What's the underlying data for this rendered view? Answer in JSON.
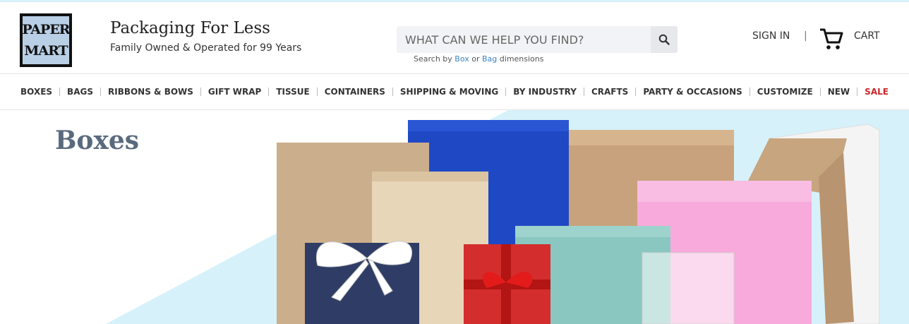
{
  "brand": {
    "logo_line1": "PAPER",
    "logo_line2": "MART",
    "title": "Packaging For Less",
    "subtitle": "Family Owned & Operated for 99 Years"
  },
  "search": {
    "placeholder": "WHAT CAN WE HELP YOU FIND?",
    "hint_prefix": "Search by",
    "hint_link1": "Box",
    "hint_middle": "or",
    "hint_link2": "Bag",
    "hint_suffix": "dimensions",
    "icon": "search-icon"
  },
  "account": {
    "sign_in": "SIGN IN",
    "separator": "|",
    "cart_label": "CART",
    "cart_icon": "cart-icon"
  },
  "nav": {
    "items": [
      "BOXES",
      "BAGS",
      "RIBBONS & BOWS",
      "GIFT WRAP",
      "TISSUE",
      "CONTAINERS",
      "SHIPPING & MOVING",
      "BY INDUSTRY",
      "CRAFTS",
      "PARTY & OCCASIONS",
      "CUSTOMIZE",
      "NEW",
      "SALE"
    ]
  },
  "hero": {
    "title": "Boxes"
  },
  "colors": {
    "accent_blue": "#3b84c7",
    "sale_red": "#c62828",
    "hero_bg": "#d6f1fa",
    "hero_title": "#5a6a7e"
  }
}
